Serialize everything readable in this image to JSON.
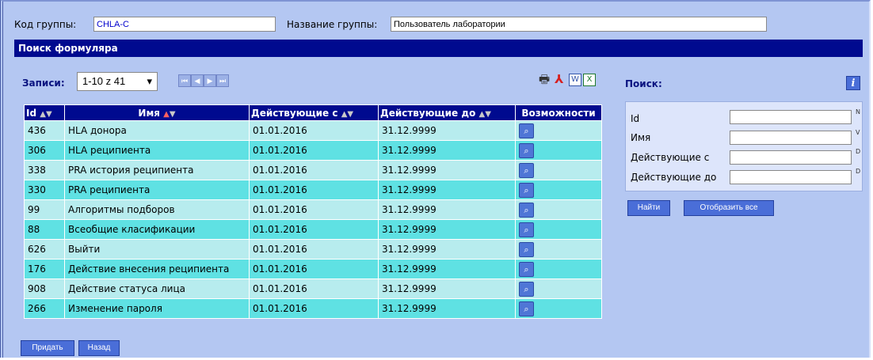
{
  "header": {
    "code_label": "Код группы:",
    "code_value": "CHLA-C",
    "name_label": "Название группы:",
    "name_value": "Пользователь лаборатории"
  },
  "section_title": "Поиск формуляра",
  "records": {
    "label": "Записи:",
    "selected": "1-10 z 41",
    "nav": [
      "first",
      "prev",
      "next",
      "last"
    ]
  },
  "export_icons": [
    "print-icon",
    "pdf-icon",
    "word-icon",
    "excel-icon"
  ],
  "table": {
    "columns": [
      "Id",
      "Имя",
      "Действующие с",
      "Действующие до",
      "Возможности"
    ],
    "rows": [
      {
        "id": "436",
        "name": "HLA донора",
        "from": "01.01.2016",
        "to": "31.12.9999"
      },
      {
        "id": "306",
        "name": "HLA реципиента",
        "from": "01.01.2016",
        "to": "31.12.9999"
      },
      {
        "id": "338",
        "name": "PRA история реципиента",
        "from": "01.01.2016",
        "to": "31.12.9999"
      },
      {
        "id": "330",
        "name": "PRA реципиента",
        "from": "01.01.2016",
        "to": "31.12.9999"
      },
      {
        "id": "99",
        "name": "Алгоритмы подборов",
        "from": "01.01.2016",
        "to": "31.12.9999"
      },
      {
        "id": "88",
        "name": "Всеобщие класификации",
        "from": "01.01.2016",
        "to": "31.12.9999"
      },
      {
        "id": "626",
        "name": "Выйти",
        "from": "01.01.2016",
        "to": "31.12.9999"
      },
      {
        "id": "176",
        "name": "Действие внесения реципиента",
        "from": "01.01.2016",
        "to": "31.12.9999"
      },
      {
        "id": "908",
        "name": "Действие статуса лица",
        "from": "01.01.2016",
        "to": "31.12.9999"
      },
      {
        "id": "266",
        "name": "Изменение пароля",
        "from": "01.01.2016",
        "to": "31.12.9999"
      }
    ]
  },
  "search": {
    "title": "Поиск:",
    "fields": [
      {
        "label": "Id",
        "type": "N"
      },
      {
        "label": "Имя",
        "type": "V"
      },
      {
        "label": "Действующие с",
        "type": "D"
      },
      {
        "label": "Действующие до",
        "type": "D"
      }
    ],
    "find_button": "Найти",
    "show_all_button": "Отобразить все"
  },
  "footer": {
    "add_button": "Придать",
    "back_button": "Назад"
  },
  "colors": {
    "background": "#b4c7f2",
    "header_bar": "#000a8f",
    "row_odd": "#b7ecee",
    "row_even": "#5fe1e3",
    "button": "#4a6ed8"
  }
}
